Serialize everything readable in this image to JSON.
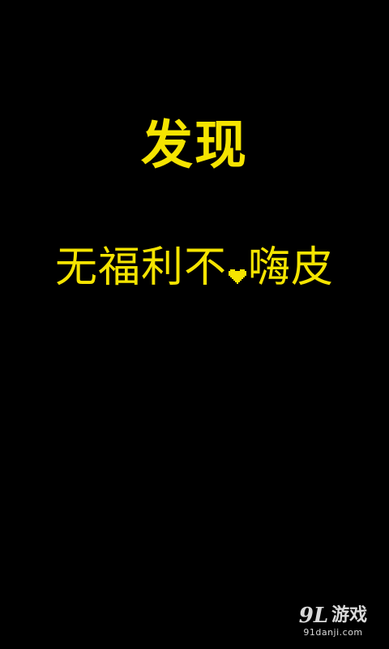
{
  "screen": {
    "headline": "发现",
    "slogan": {
      "before_heart": "无福利不",
      "after_heart": "嗨皮"
    }
  },
  "watermark": {
    "mark": "9L",
    "name": "游戏",
    "domain": "91danji.com"
  },
  "colors": {
    "background": "#000000",
    "accent": "#f5e400"
  },
  "icons": {
    "heart": "pixel-heart-icon"
  }
}
